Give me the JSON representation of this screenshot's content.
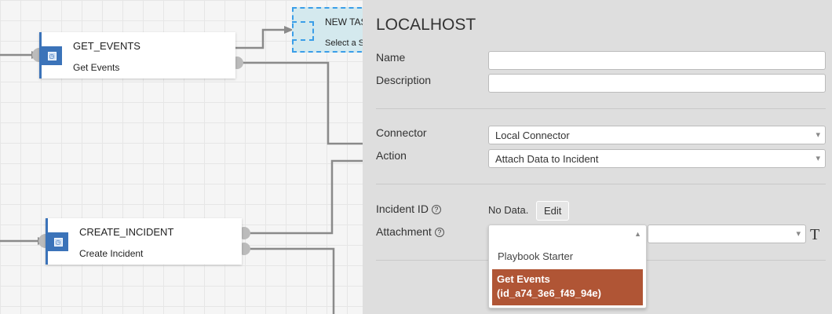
{
  "canvas": {
    "nodes": [
      {
        "title": "GET_EVENTS",
        "subtitle": "Get Events"
      },
      {
        "title": "CREATE_INCIDENT",
        "subtitle": "Create Incident"
      }
    ],
    "new_task": {
      "title": "NEW TASK",
      "subtitle": "Select a Step"
    }
  },
  "panel": {
    "title": "LOCALHOST",
    "name_label": "Name",
    "name_value": "",
    "description_label": "Description",
    "description_value": "",
    "connector_label": "Connector",
    "connector_value": "Local Connector",
    "action_label": "Action",
    "action_value": "Attach Data to Incident",
    "incident_id_label": "Incident ID",
    "incident_id_value": "No Data.",
    "edit_label": "Edit",
    "attachment_label": "Attachment",
    "attachment_options": [
      "Playbook Starter",
      "Get Events",
      "(id_a74_3e6_f49_94e)"
    ],
    "help_glyph": "?",
    "text_toggle_glyph": "T"
  },
  "colors": {
    "accent": "#3b73b9",
    "highlight": "#b05535"
  }
}
